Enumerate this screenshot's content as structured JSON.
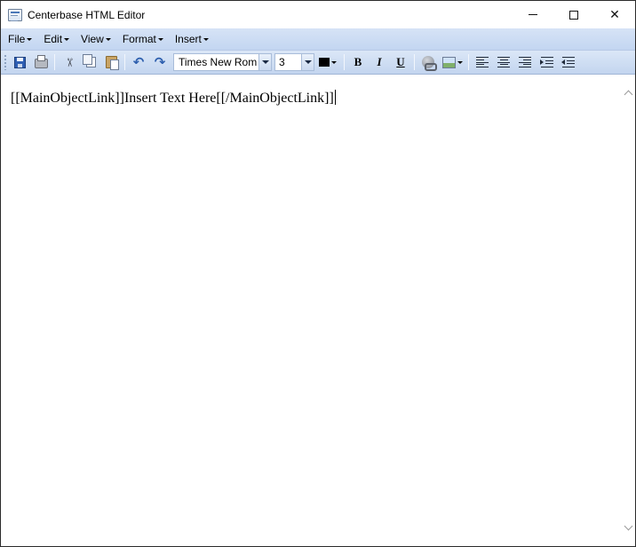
{
  "window": {
    "title": "Centerbase HTML Editor",
    "controls": {
      "minimize_icon": "minimize-icon",
      "maximize_icon": "maximize-icon",
      "close_glyph": "✕"
    }
  },
  "menu": {
    "items": [
      {
        "label": "File"
      },
      {
        "label": "Edit"
      },
      {
        "label": "View"
      },
      {
        "label": "Format"
      },
      {
        "label": "Insert"
      }
    ]
  },
  "toolbar": {
    "font_name": "Times New Rom",
    "font_size": "3",
    "font_color": "#000000",
    "bold_label": "B",
    "italic_label": "I",
    "underline_label": "U",
    "undo_glyph": "↶",
    "redo_glyph": "↷",
    "cut_glyph": "✂",
    "icons": [
      "save-icon",
      "print-icon",
      "cut-icon",
      "copy-icon",
      "paste-icon",
      "undo-icon",
      "redo-icon",
      "font-color-icon",
      "bold-icon",
      "italic-icon",
      "underline-icon",
      "hyperlink-icon",
      "image-icon",
      "align-left-icon",
      "align-center-icon",
      "align-right-icon",
      "indent-icon",
      "outdent-icon"
    ]
  },
  "editor": {
    "content": "[[MainObjectLink]]Insert Text Here[[/MainObjectLink]]"
  },
  "colors": {
    "menubar": "#c9daf3",
    "toolbar": "#cfdff4",
    "accent": "#2f5fb3"
  }
}
